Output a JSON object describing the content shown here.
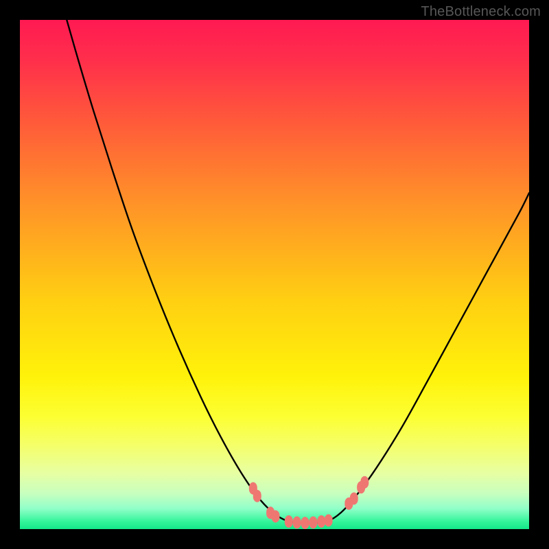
{
  "watermark": "TheBottleneck.com",
  "chart_data": {
    "type": "line",
    "title": "",
    "xlabel": "",
    "ylabel": "",
    "xlim": [
      0,
      100
    ],
    "ylim": [
      0,
      100
    ],
    "grid": false,
    "legend": false,
    "background_gradient": {
      "stops": [
        {
          "offset": 0.0,
          "color": "#ff1a52"
        },
        {
          "offset": 0.08,
          "color": "#ff2f4b"
        },
        {
          "offset": 0.2,
          "color": "#ff5a3a"
        },
        {
          "offset": 0.35,
          "color": "#ff8f29"
        },
        {
          "offset": 0.55,
          "color": "#ffcf12"
        },
        {
          "offset": 0.7,
          "color": "#fff20a"
        },
        {
          "offset": 0.78,
          "color": "#fcff33"
        },
        {
          "offset": 0.84,
          "color": "#f4ff6e"
        },
        {
          "offset": 0.89,
          "color": "#e7ffa2"
        },
        {
          "offset": 0.93,
          "color": "#c8ffbf"
        },
        {
          "offset": 0.96,
          "color": "#8fffc8"
        },
        {
          "offset": 0.985,
          "color": "#34f59a"
        },
        {
          "offset": 1.0,
          "color": "#14e889"
        }
      ]
    },
    "series": [
      {
        "name": "bottleneck-curve",
        "type": "line",
        "points": [
          {
            "x": 9.2,
            "y": 100.0
          },
          {
            "x": 11.5,
            "y": 92.0
          },
          {
            "x": 14.5,
            "y": 82.0
          },
          {
            "x": 18.0,
            "y": 71.0
          },
          {
            "x": 22.0,
            "y": 59.0
          },
          {
            "x": 26.5,
            "y": 47.0
          },
          {
            "x": 31.0,
            "y": 36.0
          },
          {
            "x": 35.5,
            "y": 26.0
          },
          {
            "x": 39.5,
            "y": 18.0
          },
          {
            "x": 43.5,
            "y": 11.0
          },
          {
            "x": 47.0,
            "y": 6.0
          },
          {
            "x": 50.0,
            "y": 3.0
          },
          {
            "x": 52.5,
            "y": 1.6
          },
          {
            "x": 55.0,
            "y": 1.2
          },
          {
            "x": 57.5,
            "y": 1.2
          },
          {
            "x": 60.5,
            "y": 1.6
          },
          {
            "x": 63.0,
            "y": 3.2
          },
          {
            "x": 66.0,
            "y": 6.5
          },
          {
            "x": 70.0,
            "y": 12.0
          },
          {
            "x": 75.0,
            "y": 20.0
          },
          {
            "x": 80.0,
            "y": 29.0
          },
          {
            "x": 86.0,
            "y": 40.0
          },
          {
            "x": 92.0,
            "y": 51.0
          },
          {
            "x": 98.0,
            "y": 62.0
          },
          {
            "x": 100.0,
            "y": 66.0
          }
        ]
      },
      {
        "name": "bottleneck-markers",
        "type": "scatter",
        "points": [
          {
            "x": 45.8,
            "y": 8.0
          },
          {
            "x": 46.6,
            "y": 6.5
          },
          {
            "x": 49.2,
            "y": 3.2
          },
          {
            "x": 50.2,
            "y": 2.5
          },
          {
            "x": 52.8,
            "y": 1.5
          },
          {
            "x": 54.4,
            "y": 1.3
          },
          {
            "x": 56.0,
            "y": 1.2
          },
          {
            "x": 57.6,
            "y": 1.3
          },
          {
            "x": 59.2,
            "y": 1.5
          },
          {
            "x": 60.6,
            "y": 1.7
          },
          {
            "x": 64.6,
            "y": 5.0
          },
          {
            "x": 65.6,
            "y": 6.0
          },
          {
            "x": 67.0,
            "y": 8.2
          },
          {
            "x": 67.7,
            "y": 9.2
          }
        ]
      }
    ]
  }
}
